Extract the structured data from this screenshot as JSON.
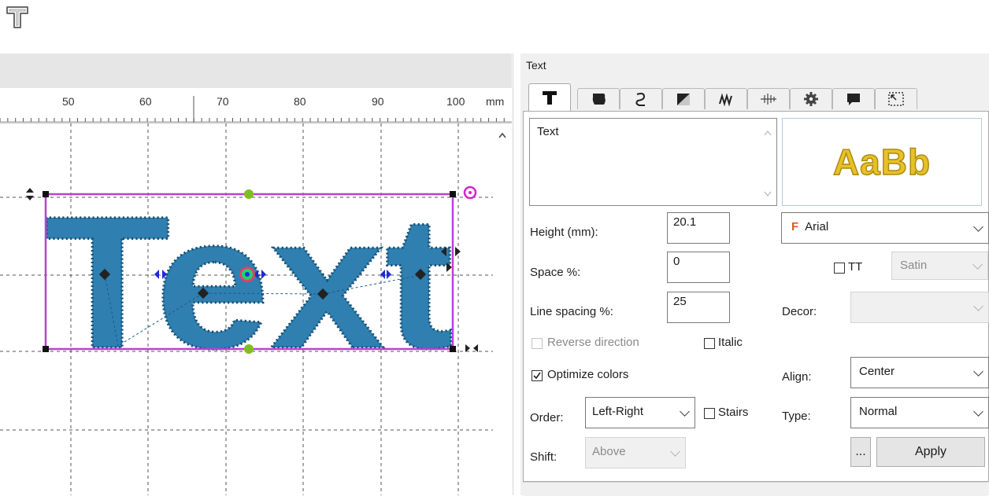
{
  "toolbar": {
    "text_tool_icon": "text-tool-icon"
  },
  "ruler": {
    "ticks": [
      "50",
      "60",
      "70",
      "80",
      "90",
      "100"
    ],
    "unit": "mm"
  },
  "canvas": {
    "sample_text": "Text",
    "stitch_color": "#1e6e99",
    "frame_color": "#c23bd6"
  },
  "panel": {
    "title": "Text",
    "tabs": [
      "text-tab-icon",
      "shape-tab-icon",
      "path-tab-icon",
      "fill-tab-icon",
      "stitch-tab-icon",
      "effects-tab-icon",
      "settings-tab-icon",
      "comment-tab-icon",
      "size-tab-icon"
    ],
    "text_value": "Text",
    "preview_text": "AaBb",
    "preview_color": "#e6c228",
    "height_label": "Height (mm):",
    "height_value": "20.1",
    "space_label": "Space %:",
    "space_value": "0",
    "line_spacing_label": "Line spacing %:",
    "line_spacing_value": "25",
    "font_name": "Arial",
    "font_icon_letter": "F",
    "tt_label": "TT",
    "tt_checked": false,
    "stitch_type": "Satin",
    "decor_label": "Decor:",
    "decor_value": "",
    "reverse_label": "Reverse direction",
    "reverse_checked": false,
    "italic_label": "Italic",
    "italic_checked": false,
    "optimize_label": "Optimize colors",
    "optimize_checked": true,
    "align_label": "Align:",
    "align_value": "Center",
    "order_label": "Order:",
    "order_value": "Left-Right",
    "stairs_label": "Stairs",
    "stairs_checked": false,
    "type_label": "Type:",
    "type_value": "Normal",
    "shift_label": "Shift:",
    "shift_value": "Above",
    "more_label": "...",
    "apply_label": "Apply"
  }
}
